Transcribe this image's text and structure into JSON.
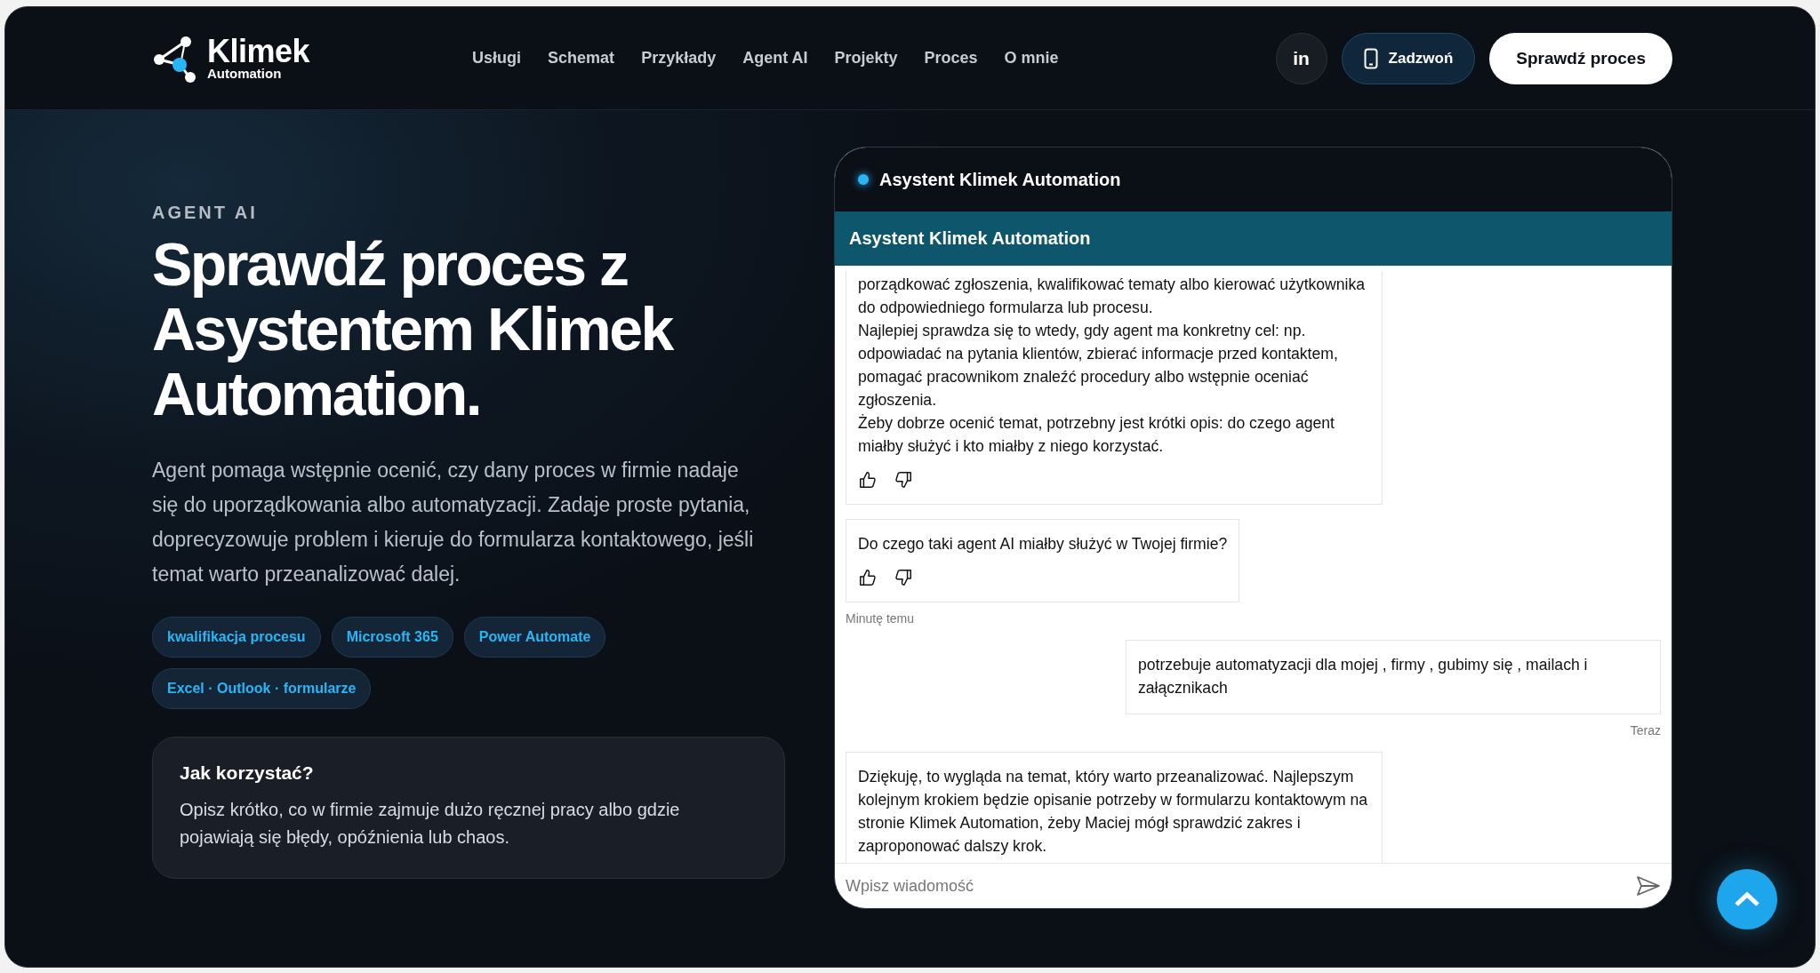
{
  "header": {
    "logo": {
      "name": "Klimek",
      "subtitle": "Automation"
    },
    "nav": [
      "Usługi",
      "Schemat",
      "Przykłady",
      "Agent AI",
      "Projekty",
      "Proces",
      "O mnie"
    ],
    "linkedin": "in",
    "call_button": "Zadzwoń",
    "cta_button": "Sprawdź proces"
  },
  "hero": {
    "eyebrow": "AGENT AI",
    "title": "Sprawdź proces z Asystentem Klimek Automation.",
    "description": "Agent pomaga wstępnie ocenić, czy dany proces w firmie nadaje się do uporządkowania albo automatyzacji. Zadaje proste pytania, doprecyzowuje problem i kieruje do formularza kontaktowego, jeśli temat warto przeanalizować dalej.",
    "tags": [
      "kwalifikacja procesu",
      "Microsoft 365",
      "Power Automate",
      "Excel · Outlook · formularze"
    ],
    "tip": {
      "title": "Jak korzystać?",
      "text": "Opisz krótko, co w firmie zajmuje dużo ręcznej pracy albo gdzie pojawiają się błędy, opóźnienia lub chaos."
    }
  },
  "chat": {
    "title": "Asystent Klimek Automation",
    "bar_title": "Asystent Klimek Automation",
    "messages": [
      {
        "kind": "bot",
        "paragraphs": [
          "porządkować zgłoszenia, kwalifikować tematy albo kierować użytkownika do odpowiedniego formularza lub procesu.",
          "Najlepiej sprawdza się to wtedy, gdy agent ma konkretny cel: np. odpowiadać na pytania klientów, zbierać informacje przed kontaktem, pomagać pracownikom znaleźć procedury albo wstępnie oceniać zgłoszenia.",
          "Żeby dobrze ocenić temat, potrzebny jest krótki opis: do czego agent miałby służyć i kto miałby z niego korzystać."
        ],
        "feedback": true
      },
      {
        "kind": "bot",
        "paragraphs": [
          "Do czego taki agent AI miałby służyć w Twojej firmie?"
        ],
        "feedback": true,
        "time": "Minutę temu"
      },
      {
        "kind": "user",
        "paragraphs": [
          "potrzebuje automatyzacji dla mojej , firmy , gubimy się , mailach i załącznikach"
        ],
        "feedback": false,
        "time": "Teraz"
      },
      {
        "kind": "bot",
        "paragraphs": [
          "Dziękuję, to wygląda na temat, który warto przeanalizować. Najlepszym kolejnym krokiem będzie opisanie potrzeby w formularzu kontaktowym na stronie Klimek Automation, żeby Maciej mógł sprawdzić zakres i zaproponować dalszy krok."
        ],
        "feedback": false
      }
    ],
    "input": {
      "placeholder": "Wpisz wiadomość"
    }
  }
}
